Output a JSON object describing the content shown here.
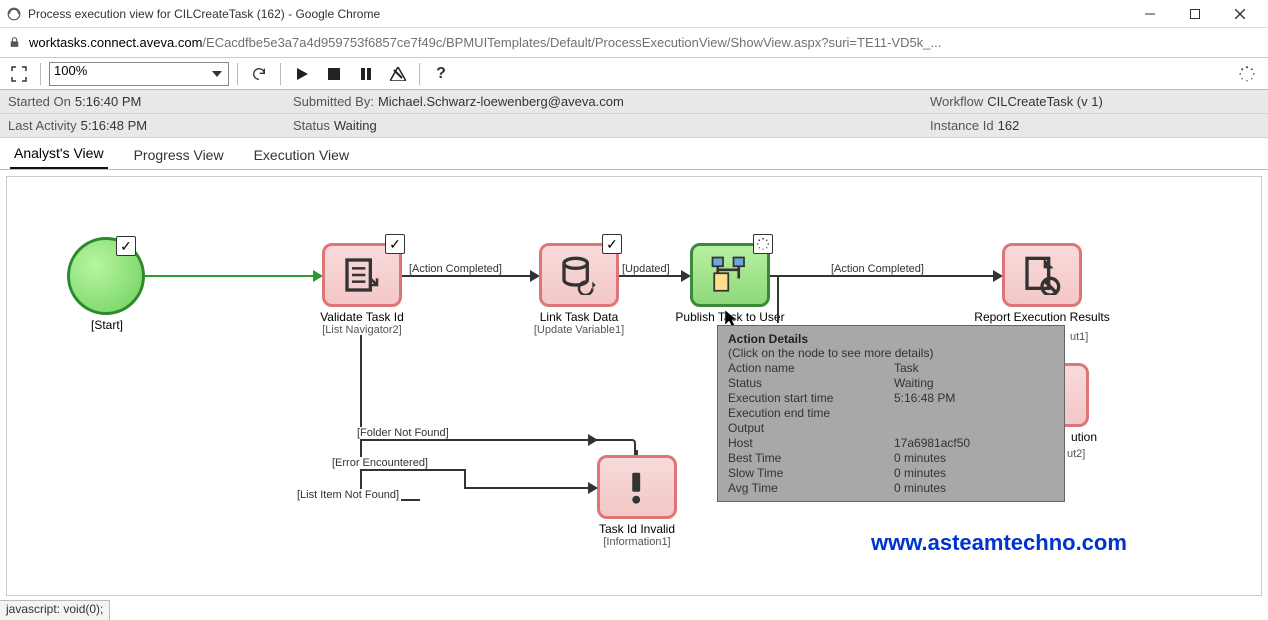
{
  "window": {
    "title": "Process execution view for CILCreateTask (162) - Google Chrome"
  },
  "address": {
    "host": "worktasks.connect.aveva.com",
    "path": "/ECacdfbe5e3a7a4d959753f6857ce7f49c/BPMUITemplates/Default/ProcessExecutionView/ShowView.aspx?suri=TE11-VD5k_..."
  },
  "toolbar": {
    "zoom": "100%"
  },
  "info": {
    "started_on_label": "Started On",
    "started_on_value": "5:16:40 PM",
    "last_activity_label": "Last Activity",
    "last_activity_value": "5:16:48 PM",
    "submitted_by_label": "Submitted By:",
    "submitted_by_value": "Michael.Schwarz-loewenberg@aveva.com",
    "status_label": "Status",
    "status_value": "Waiting",
    "workflow_label": "Workflow",
    "workflow_value": "CILCreateTask (v 1)",
    "instance_label": "Instance Id",
    "instance_value": "162"
  },
  "tabs": {
    "analyst": "Analyst's View",
    "progress": "Progress View",
    "execution": "Execution View"
  },
  "nodes": {
    "start": {
      "label": "[Start]"
    },
    "validate": {
      "label": "Validate Task Id",
      "sub": "[List Navigator2]"
    },
    "link": {
      "label": "Link Task Data",
      "sub": "[Update Variable1]"
    },
    "publish": {
      "label": "Publish Task to User"
    },
    "report": {
      "label": "Report Execution Results",
      "sub_partial": "ut1]"
    },
    "invalid": {
      "label": "Task Id Invalid",
      "sub": "[Information1]"
    },
    "hidden_right": {
      "label_partial": "ution",
      "sub_partial": "ut2]"
    }
  },
  "edges": {
    "action_completed": "[Action Completed]",
    "updated": "[Updated]",
    "folder_not_found": "[Folder Not Found]",
    "error_encountered": "[Error Encountered]",
    "list_item_not_found": "[List Item Not Found]"
  },
  "tooltip": {
    "title": "Action Details",
    "subtitle": "(Click on the node to see more details)",
    "rows": {
      "action_name_k": "Action name",
      "action_name_v": "Task",
      "status_k": "Status",
      "status_v": "Waiting",
      "exec_start_k": "Execution start time",
      "exec_start_v": "5:16:48 PM",
      "exec_end_k": "Execution end time",
      "exec_end_v": "",
      "output_k": "Output",
      "output_v": "",
      "host_k": "Host",
      "host_v": "17a6981acf50",
      "best_k": "Best Time",
      "best_v": "0 minutes",
      "slow_k": "Slow Time",
      "slow_v": "0 minutes",
      "avg_k": "Avg Time",
      "avg_v": "0 minutes"
    }
  },
  "watermark": "www.asteamtechno.com",
  "statusbar": "javascript: void(0);"
}
